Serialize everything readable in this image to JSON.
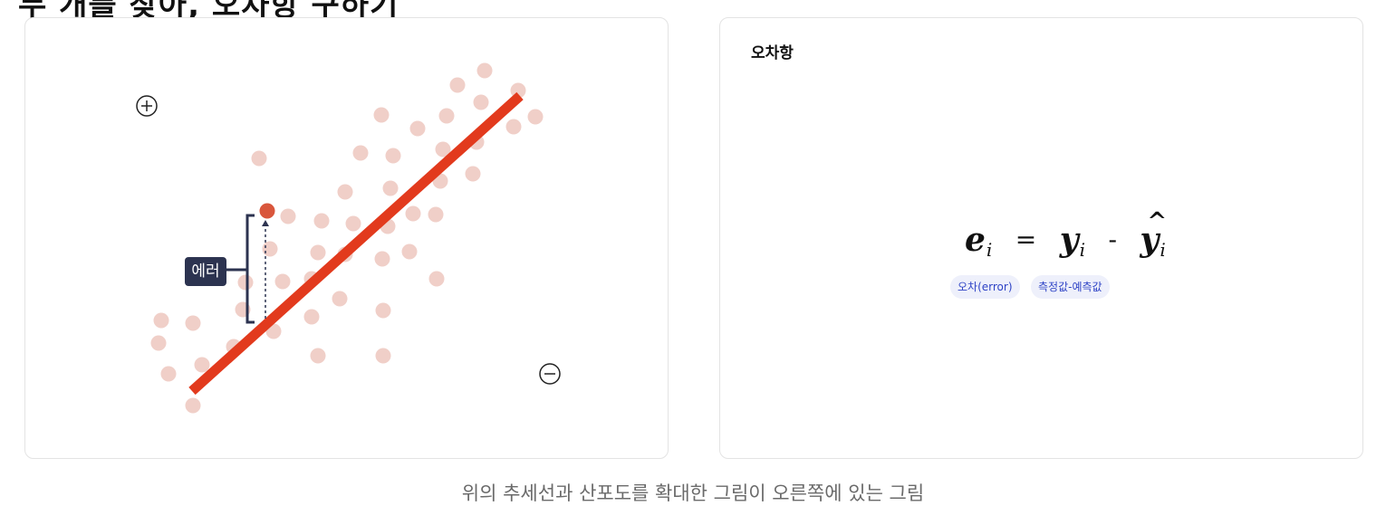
{
  "heading": "두 개를 찾아, 오차항 구하기",
  "left_panel": {
    "plus_symbol": "+",
    "minus_symbol": "−",
    "error_label": "에러",
    "colors": {
      "point": "#f0cfc8",
      "highlight_point": "#d9563c",
      "trend_line": "#e23a1d",
      "bracket": "#2c3350"
    }
  },
  "right_panel": {
    "title": "오차항",
    "formula": {
      "lhs": "e",
      "lhs_sub": "i",
      "equals": "=",
      "term1": "y",
      "term1_sub": "i",
      "minus": "-",
      "term2": "y",
      "term2_hat": "^",
      "term2_sub": "i"
    },
    "chips": [
      "오차(error)",
      "측정값-예측값"
    ]
  },
  "caption": "위의 추세선과 산포도를 확대한 그림이 오른쪽에 있는 그림"
}
